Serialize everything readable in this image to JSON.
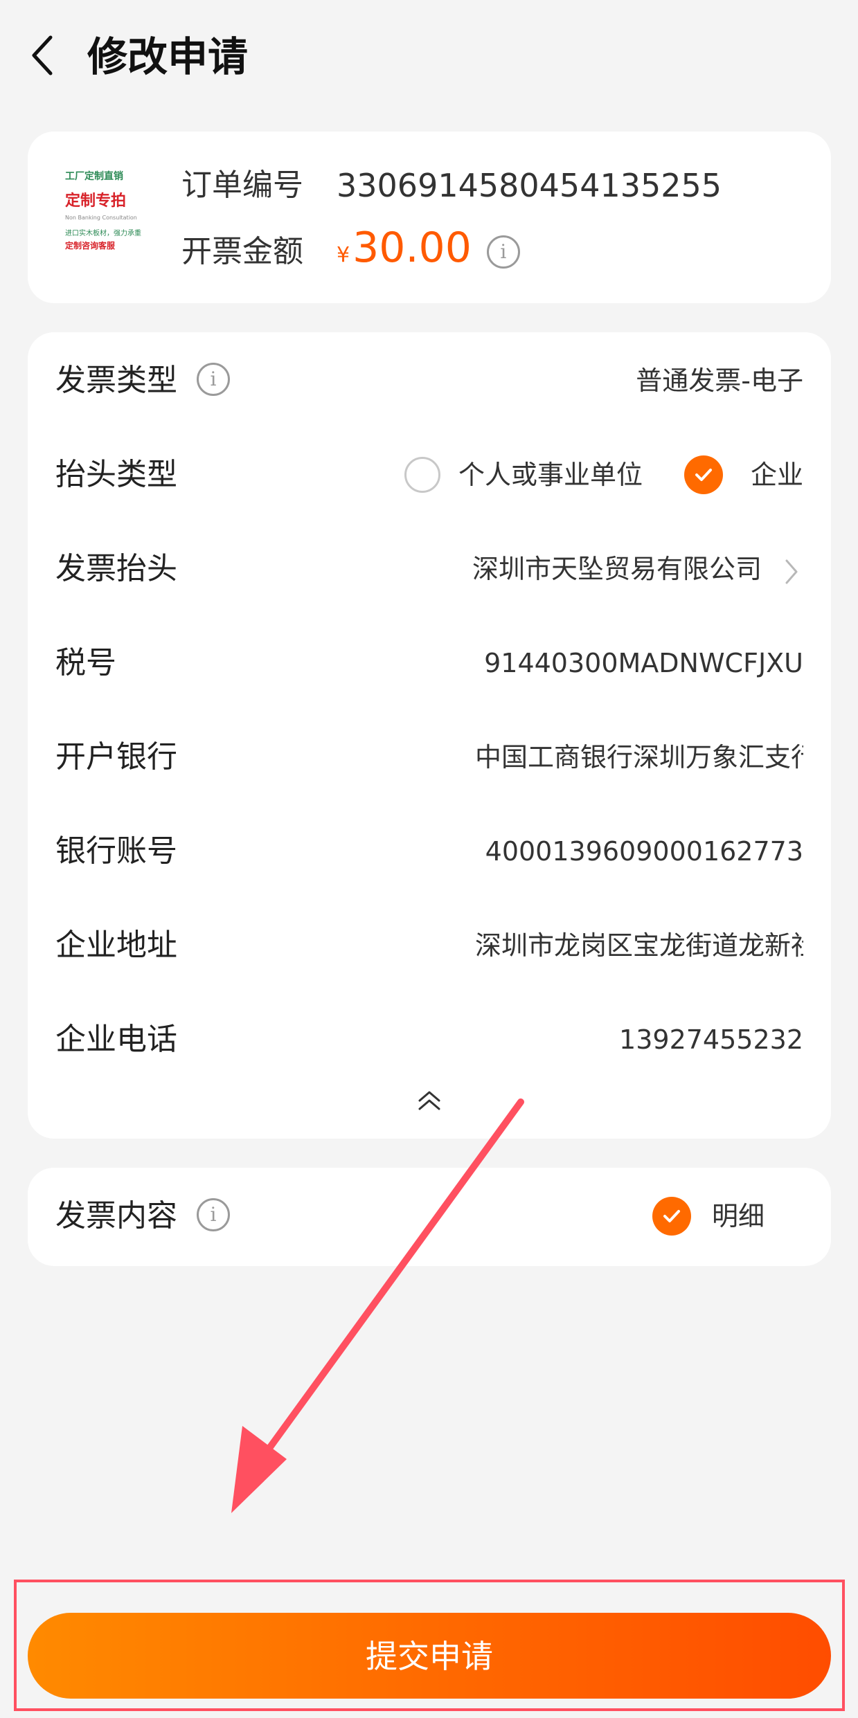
{
  "header": {
    "title": "修改申请"
  },
  "order": {
    "number_label": "订单编号",
    "number": "3306914580454135255",
    "amount_label": "开票金额",
    "currency": "¥",
    "amount": "30.00",
    "thumbnail": {
      "line1": "工厂定制直销",
      "line2": "定制专拍",
      "line3": "Non Banking Consultation",
      "line4": "进口实木板材，强力承重",
      "line5": "定制咨询客服"
    }
  },
  "invoice": {
    "type_label": "发票类型",
    "type_value": "普通发票-电子",
    "title_type_label": "抬头类型",
    "title_type_options": [
      "个人或事业单位",
      "企业"
    ],
    "title_type_selected": "企业",
    "title_label": "发票抬头",
    "title_value": "深圳市天坠贸易有限公司",
    "tax_label": "税号",
    "tax_value": "91440300MADNWCFJXU",
    "bank_label": "开户银行",
    "bank_value": "中国工商银行深圳万象汇支行",
    "account_label": "银行账号",
    "account_value": "4000139609000162773",
    "address_label": "企业地址",
    "address_value": "深圳市龙岗区宝龙街道龙新社区",
    "phone_label": "企业电话",
    "phone_value": "13927455232"
  },
  "content": {
    "label": "发票内容",
    "option": "明细"
  },
  "submit": {
    "label": "提交申请"
  },
  "colors": {
    "accent": "#ff6a00",
    "highlight": "#ff5060"
  }
}
